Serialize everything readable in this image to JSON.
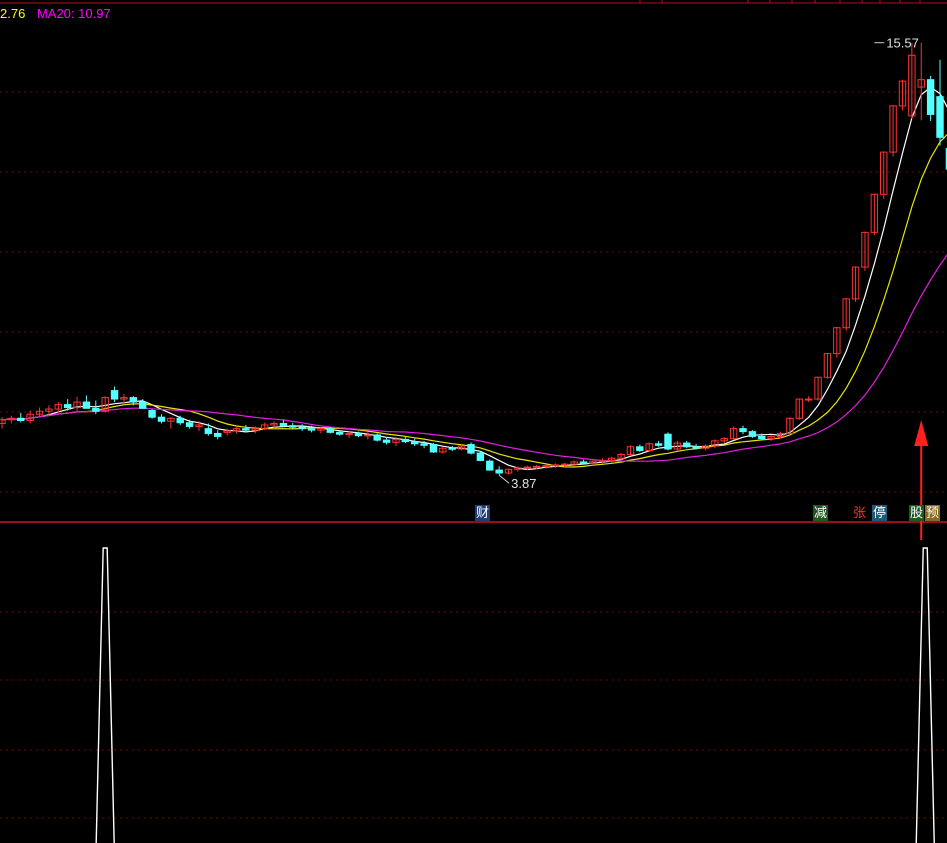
{
  "legend": {
    "ma10_text": "2.76",
    "ma20_text": "MA20: 10.97",
    "ma10_color": "#ffff00",
    "ma20_color": "#ff00ff"
  },
  "markers": {
    "low_label": "3.87",
    "high_label": "15.57"
  },
  "event_tags": [
    {
      "text": "财",
      "bg": "#1e3c78",
      "color": "#ffffff"
    },
    {
      "text": "减",
      "bg": "#1e5a1e",
      "color": "#ffffff"
    },
    {
      "text": "张",
      "bg": "#000000",
      "color": "#ff3030"
    },
    {
      "text": "停",
      "bg": "#1e5a78",
      "color": "#ffffff"
    },
    {
      "text": "股",
      "bg": "#1e5a1e",
      "color": "#ffffff"
    },
    {
      "text": "预",
      "bg": "#8a6a1e",
      "color": "#ffffff"
    }
  ],
  "colors": {
    "up": "#ff3232",
    "down": "#54ffff",
    "grid": "#7a0000",
    "ma5": "#ffffff",
    "ma10": "#e6e600",
    "ma20": "#e020e0",
    "signal": "#ffffff",
    "arrow": "#ff2020"
  },
  "chart_data": {
    "type": "candlestick",
    "price_range": [
      3.2,
      16.4
    ],
    "candles": [
      {
        "o": 5.27,
        "h": 5.44,
        "l": 5.13,
        "c": 5.37
      },
      {
        "o": 5.37,
        "h": 5.48,
        "l": 5.27,
        "c": 5.41
      },
      {
        "o": 5.41,
        "h": 5.56,
        "l": 5.3,
        "c": 5.35
      },
      {
        "o": 5.35,
        "h": 5.62,
        "l": 5.27,
        "c": 5.52
      },
      {
        "o": 5.52,
        "h": 5.7,
        "l": 5.44,
        "c": 5.6
      },
      {
        "o": 5.6,
        "h": 5.76,
        "l": 5.48,
        "c": 5.66
      },
      {
        "o": 5.66,
        "h": 5.85,
        "l": 5.56,
        "c": 5.78
      },
      {
        "o": 5.78,
        "h": 5.93,
        "l": 5.62,
        "c": 5.7
      },
      {
        "o": 5.7,
        "h": 5.99,
        "l": 5.6,
        "c": 5.85
      },
      {
        "o": 5.85,
        "h": 6.03,
        "l": 5.7,
        "c": 5.68
      },
      {
        "o": 5.68,
        "h": 5.89,
        "l": 5.52,
        "c": 5.6
      },
      {
        "o": 5.6,
        "h": 6.01,
        "l": 5.56,
        "c": 5.97
      },
      {
        "o": 6.16,
        "h": 6.27,
        "l": 5.85,
        "c": 5.93
      },
      {
        "o": 5.93,
        "h": 6.07,
        "l": 5.8,
        "c": 5.97
      },
      {
        "o": 5.97,
        "h": 6.01,
        "l": 5.76,
        "c": 5.85
      },
      {
        "o": 5.85,
        "h": 5.93,
        "l": 5.66,
        "c": 5.68
      },
      {
        "o": 5.62,
        "h": 5.66,
        "l": 5.4,
        "c": 5.44
      },
      {
        "o": 5.44,
        "h": 5.52,
        "l": 5.27,
        "c": 5.33
      },
      {
        "o": 5.33,
        "h": 5.44,
        "l": 5.13,
        "c": 5.41
      },
      {
        "o": 5.41,
        "h": 5.48,
        "l": 5.23,
        "c": 5.29
      },
      {
        "o": 5.29,
        "h": 5.37,
        "l": 5.13,
        "c": 5.19
      },
      {
        "o": 5.19,
        "h": 5.33,
        "l": 5.07,
        "c": 5.23
      },
      {
        "o": 5.13,
        "h": 5.27,
        "l": 4.94,
        "c": 5.0
      },
      {
        "o": 5.0,
        "h": 5.09,
        "l": 4.84,
        "c": 4.92
      },
      {
        "o": 5.03,
        "h": 5.13,
        "l": 4.94,
        "c": 5.07
      },
      {
        "o": 5.07,
        "h": 5.17,
        "l": 5.0,
        "c": 5.13
      },
      {
        "o": 5.13,
        "h": 5.23,
        "l": 5.03,
        "c": 5.09
      },
      {
        "o": 5.09,
        "h": 5.19,
        "l": 5.0,
        "c": 5.13
      },
      {
        "o": 5.13,
        "h": 5.29,
        "l": 5.09,
        "c": 5.23
      },
      {
        "o": 5.23,
        "h": 5.33,
        "l": 5.13,
        "c": 5.27
      },
      {
        "o": 5.27,
        "h": 5.37,
        "l": 5.17,
        "c": 5.21
      },
      {
        "o": 5.21,
        "h": 5.29,
        "l": 5.13,
        "c": 5.17
      },
      {
        "o": 5.17,
        "h": 5.25,
        "l": 5.07,
        "c": 5.13
      },
      {
        "o": 5.13,
        "h": 5.21,
        "l": 5.03,
        "c": 5.09
      },
      {
        "o": 5.09,
        "h": 5.17,
        "l": 5.0,
        "c": 5.13
      },
      {
        "o": 5.13,
        "h": 5.17,
        "l": 5.0,
        "c": 5.03
      },
      {
        "o": 5.03,
        "h": 5.09,
        "l": 4.94,
        "c": 4.98
      },
      {
        "o": 4.98,
        "h": 5.05,
        "l": 4.88,
        "c": 5.0
      },
      {
        "o": 5.0,
        "h": 5.05,
        "l": 4.9,
        "c": 4.94
      },
      {
        "o": 4.94,
        "h": 5.03,
        "l": 4.84,
        "c": 4.96
      },
      {
        "o": 4.96,
        "h": 5.0,
        "l": 4.78,
        "c": 4.82
      },
      {
        "o": 4.82,
        "h": 4.9,
        "l": 4.7,
        "c": 4.76
      },
      {
        "o": 4.76,
        "h": 4.9,
        "l": 4.66,
        "c": 4.84
      },
      {
        "o": 4.84,
        "h": 4.92,
        "l": 4.74,
        "c": 4.78
      },
      {
        "o": 4.78,
        "h": 4.86,
        "l": 4.66,
        "c": 4.72
      },
      {
        "o": 4.72,
        "h": 4.8,
        "l": 4.6,
        "c": 4.68
      },
      {
        "o": 4.7,
        "h": 4.74,
        "l": 4.47,
        "c": 4.5
      },
      {
        "o": 4.5,
        "h": 4.64,
        "l": 4.45,
        "c": 4.6
      },
      {
        "o": 4.6,
        "h": 4.66,
        "l": 4.52,
        "c": 4.58
      },
      {
        "o": 4.58,
        "h": 4.7,
        "l": 4.54,
        "c": 4.66
      },
      {
        "o": 4.7,
        "h": 4.76,
        "l": 4.43,
        "c": 4.47
      },
      {
        "o": 4.47,
        "h": 4.52,
        "l": 4.25,
        "c": 4.27
      },
      {
        "o": 4.25,
        "h": 4.29,
        "l": 3.99,
        "c": 4.01
      },
      {
        "o": 4.01,
        "h": 4.11,
        "l": 3.87,
        "c": 3.93
      },
      {
        "o": 3.93,
        "h": 4.05,
        "l": 3.89,
        "c": 4.03
      },
      {
        "o": 4.03,
        "h": 4.11,
        "l": 3.97,
        "c": 4.07
      },
      {
        "o": 4.07,
        "h": 4.13,
        "l": 4.01,
        "c": 4.09
      },
      {
        "o": 4.09,
        "h": 4.15,
        "l": 4.03,
        "c": 4.11
      },
      {
        "o": 4.11,
        "h": 4.17,
        "l": 4.05,
        "c": 4.13
      },
      {
        "o": 4.13,
        "h": 4.19,
        "l": 4.07,
        "c": 4.15
      },
      {
        "o": 4.15,
        "h": 4.21,
        "l": 4.09,
        "c": 4.17
      },
      {
        "o": 4.17,
        "h": 4.27,
        "l": 4.11,
        "c": 4.23
      },
      {
        "o": 4.23,
        "h": 4.29,
        "l": 4.17,
        "c": 4.19
      },
      {
        "o": 4.19,
        "h": 4.27,
        "l": 4.13,
        "c": 4.25
      },
      {
        "o": 4.25,
        "h": 4.33,
        "l": 4.19,
        "c": 4.27
      },
      {
        "o": 4.27,
        "h": 4.37,
        "l": 4.21,
        "c": 4.33
      },
      {
        "o": 4.33,
        "h": 4.47,
        "l": 4.27,
        "c": 4.43
      },
      {
        "o": 4.43,
        "h": 4.68,
        "l": 4.39,
        "c": 4.64
      },
      {
        "o": 4.64,
        "h": 4.7,
        "l": 4.5,
        "c": 4.54
      },
      {
        "o": 4.54,
        "h": 4.76,
        "l": 4.5,
        "c": 4.72
      },
      {
        "o": 4.72,
        "h": 4.8,
        "l": 4.64,
        "c": 4.68
      },
      {
        "o": 4.98,
        "h": 5.03,
        "l": 4.54,
        "c": 4.58
      },
      {
        "o": 4.58,
        "h": 4.8,
        "l": 4.54,
        "c": 4.74
      },
      {
        "o": 4.74,
        "h": 4.8,
        "l": 4.6,
        "c": 4.64
      },
      {
        "o": 4.64,
        "h": 4.72,
        "l": 4.56,
        "c": 4.6
      },
      {
        "o": 4.6,
        "h": 4.7,
        "l": 4.54,
        "c": 4.66
      },
      {
        "o": 4.66,
        "h": 4.84,
        "l": 4.6,
        "c": 4.8
      },
      {
        "o": 4.8,
        "h": 4.9,
        "l": 4.74,
        "c": 4.86
      },
      {
        "o": 4.86,
        "h": 5.19,
        "l": 4.82,
        "c": 5.13
      },
      {
        "o": 5.13,
        "h": 5.21,
        "l": 4.98,
        "c": 5.05
      },
      {
        "o": 5.05,
        "h": 5.09,
        "l": 4.88,
        "c": 4.92
      },
      {
        "o": 4.92,
        "h": 5.0,
        "l": 4.82,
        "c": 4.86
      },
      {
        "o": 4.86,
        "h": 4.96,
        "l": 4.8,
        "c": 4.92
      },
      {
        "o": 4.92,
        "h": 5.05,
        "l": 4.86,
        "c": 5.0
      },
      {
        "o": 5.0,
        "h": 5.44,
        "l": 4.96,
        "c": 5.41
      },
      {
        "o": 5.41,
        "h": 5.95,
        "l": 5.37,
        "c": 5.93
      },
      {
        "o": 5.93,
        "h": 6.01,
        "l": 5.85,
        "c": 5.93
      },
      {
        "o": 5.93,
        "h": 6.54,
        "l": 5.89,
        "c": 6.52
      },
      {
        "o": 6.52,
        "h": 7.18,
        "l": 6.48,
        "c": 7.16
      },
      {
        "o": 7.16,
        "h": 7.88,
        "l": 7.06,
        "c": 7.86
      },
      {
        "o": 7.86,
        "h": 8.66,
        "l": 7.78,
        "c": 8.64
      },
      {
        "o": 8.64,
        "h": 9.52,
        "l": 8.56,
        "c": 9.5
      },
      {
        "o": 9.5,
        "h": 10.46,
        "l": 9.4,
        "c": 10.44
      },
      {
        "o": 10.44,
        "h": 11.49,
        "l": 10.36,
        "c": 11.47
      },
      {
        "o": 11.47,
        "h": 12.63,
        "l": 11.35,
        "c": 12.61
      },
      {
        "o": 12.61,
        "h": 13.88,
        "l": 12.49,
        "c": 13.86
      },
      {
        "o": 13.86,
        "h": 14.57,
        "l": 13.74,
        "c": 14.53
      },
      {
        "o": 13.59,
        "h": 15.57,
        "l": 13.51,
        "c": 15.23
      },
      {
        "o": 14.37,
        "h": 15.57,
        "l": 13.47,
        "c": 14.57
      },
      {
        "o": 14.57,
        "h": 14.67,
        "l": 13.45,
        "c": 13.63
      },
      {
        "o": 14.11,
        "h": 15.11,
        "l": 12.79,
        "c": 13.01
      },
      {
        "o": 12.71,
        "h": 12.79,
        "l": 12.07,
        "c": 12.15
      },
      {
        "o": 12.07,
        "h": 12.17,
        "l": 11.05,
        "c": 11.09
      },
      {
        "o": 11.05,
        "h": 11.47,
        "l": 10.6,
        "c": 10.64
      }
    ],
    "ma5_label": "",
    "ma10_label": "2.76",
    "ma20_label": "MA20: 10.97",
    "signal_spikes": [
      11,
      98
    ],
    "low_point": {
      "index": 53,
      "value": 3.87
    },
    "high_point": {
      "index": 93,
      "value": 15.57
    }
  }
}
